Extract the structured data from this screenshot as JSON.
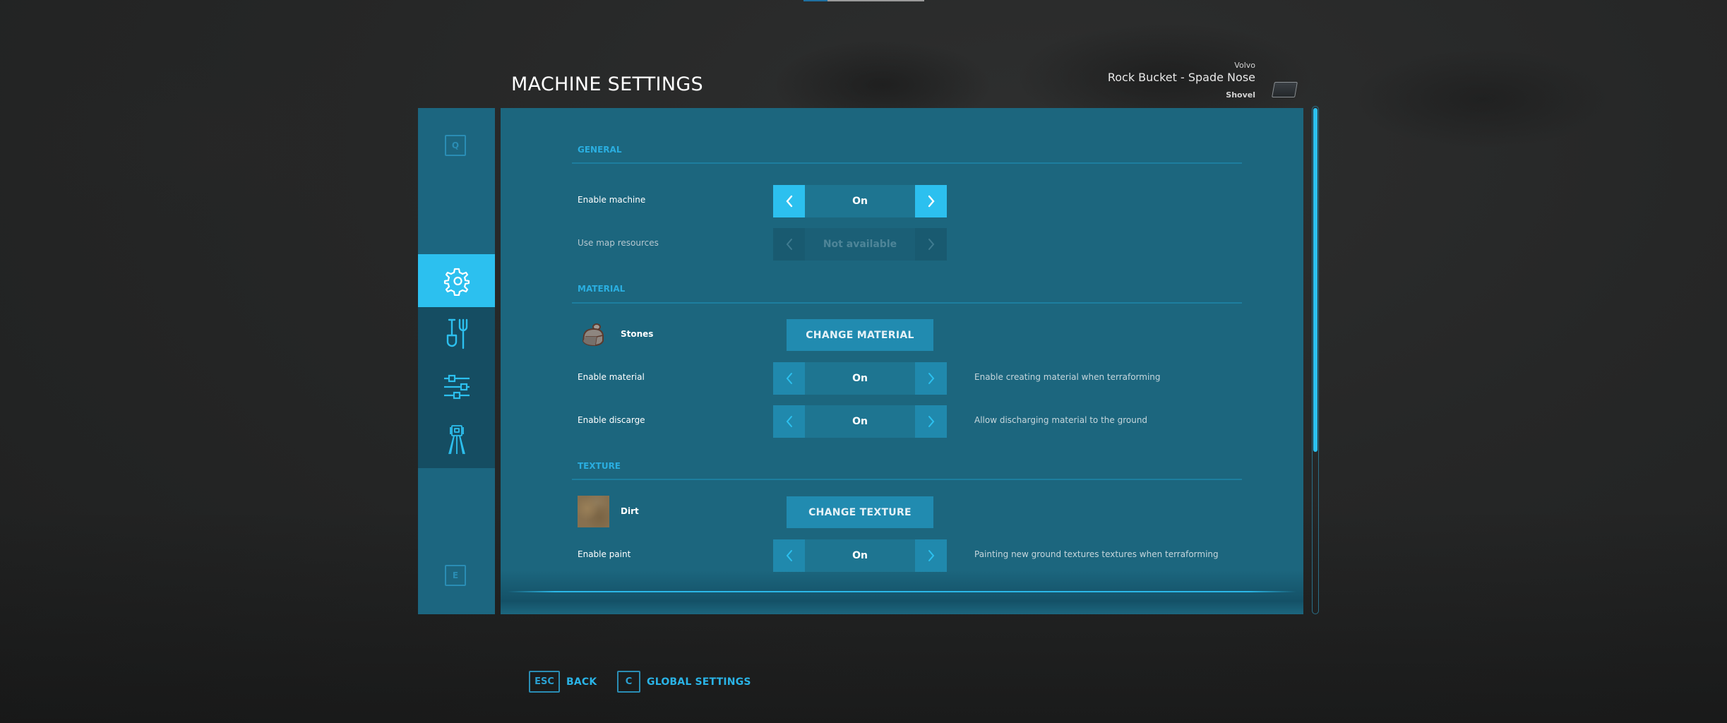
{
  "top_progress": {
    "fraction": 0.2
  },
  "header": {
    "title": "MACHINE SETTINGS",
    "machine": {
      "brand": "Volvo",
      "name": "Rock Bucket - Spade Nose",
      "type": "Shovel",
      "thumbnail_icon": "shovel-thumbnail"
    }
  },
  "sidebar": {
    "prev_key": "Q",
    "next_key": "E",
    "tabs": [
      {
        "icon": "gear-icon",
        "label": "Machine settings",
        "active": true
      },
      {
        "icon": "shovel-fork-icon",
        "label": "Tools",
        "active": false
      },
      {
        "icon": "sliders-icon",
        "label": "Adjustments",
        "active": false
      },
      {
        "icon": "survey-tripod-icon",
        "label": "Surveying",
        "active": false
      }
    ]
  },
  "sections": {
    "general": {
      "title": "GENERAL",
      "enable_machine": {
        "label": "Enable machine",
        "value": "On",
        "state": "focused"
      },
      "use_map_resources": {
        "label": "Use map resources",
        "value": "Not available",
        "state": "disabled"
      }
    },
    "material": {
      "title": "MATERIAL",
      "current": {
        "name": "Stones",
        "icon": "stones-icon"
      },
      "change_button": "CHANGE MATERIAL",
      "enable_material": {
        "label": "Enable material",
        "value": "On",
        "description": "Enable creating material when terraforming"
      },
      "enable_discharge": {
        "label": "Enable discarge",
        "value": "On",
        "description": "Allow discharging material to the ground"
      }
    },
    "texture": {
      "title": "TEXTURE",
      "current": {
        "name": "Dirt",
        "icon": "dirt-texture"
      },
      "change_button": "CHANGE TEXTURE",
      "enable_paint": {
        "label": "Enable paint",
        "value": "On",
        "description": "Painting new ground textures textures when terraforming"
      }
    }
  },
  "scrollbar": {
    "visible_fraction": 0.68,
    "position": 0.0
  },
  "footer": {
    "back": {
      "key": "ESC",
      "label": "BACK"
    },
    "global_settings": {
      "key": "C",
      "label": "GLOBAL SETTINGS"
    }
  },
  "colors": {
    "accent": "#2cc0ef",
    "panel": "#1c667e",
    "section_header": "#2aaee0",
    "button": "#218bb0"
  }
}
